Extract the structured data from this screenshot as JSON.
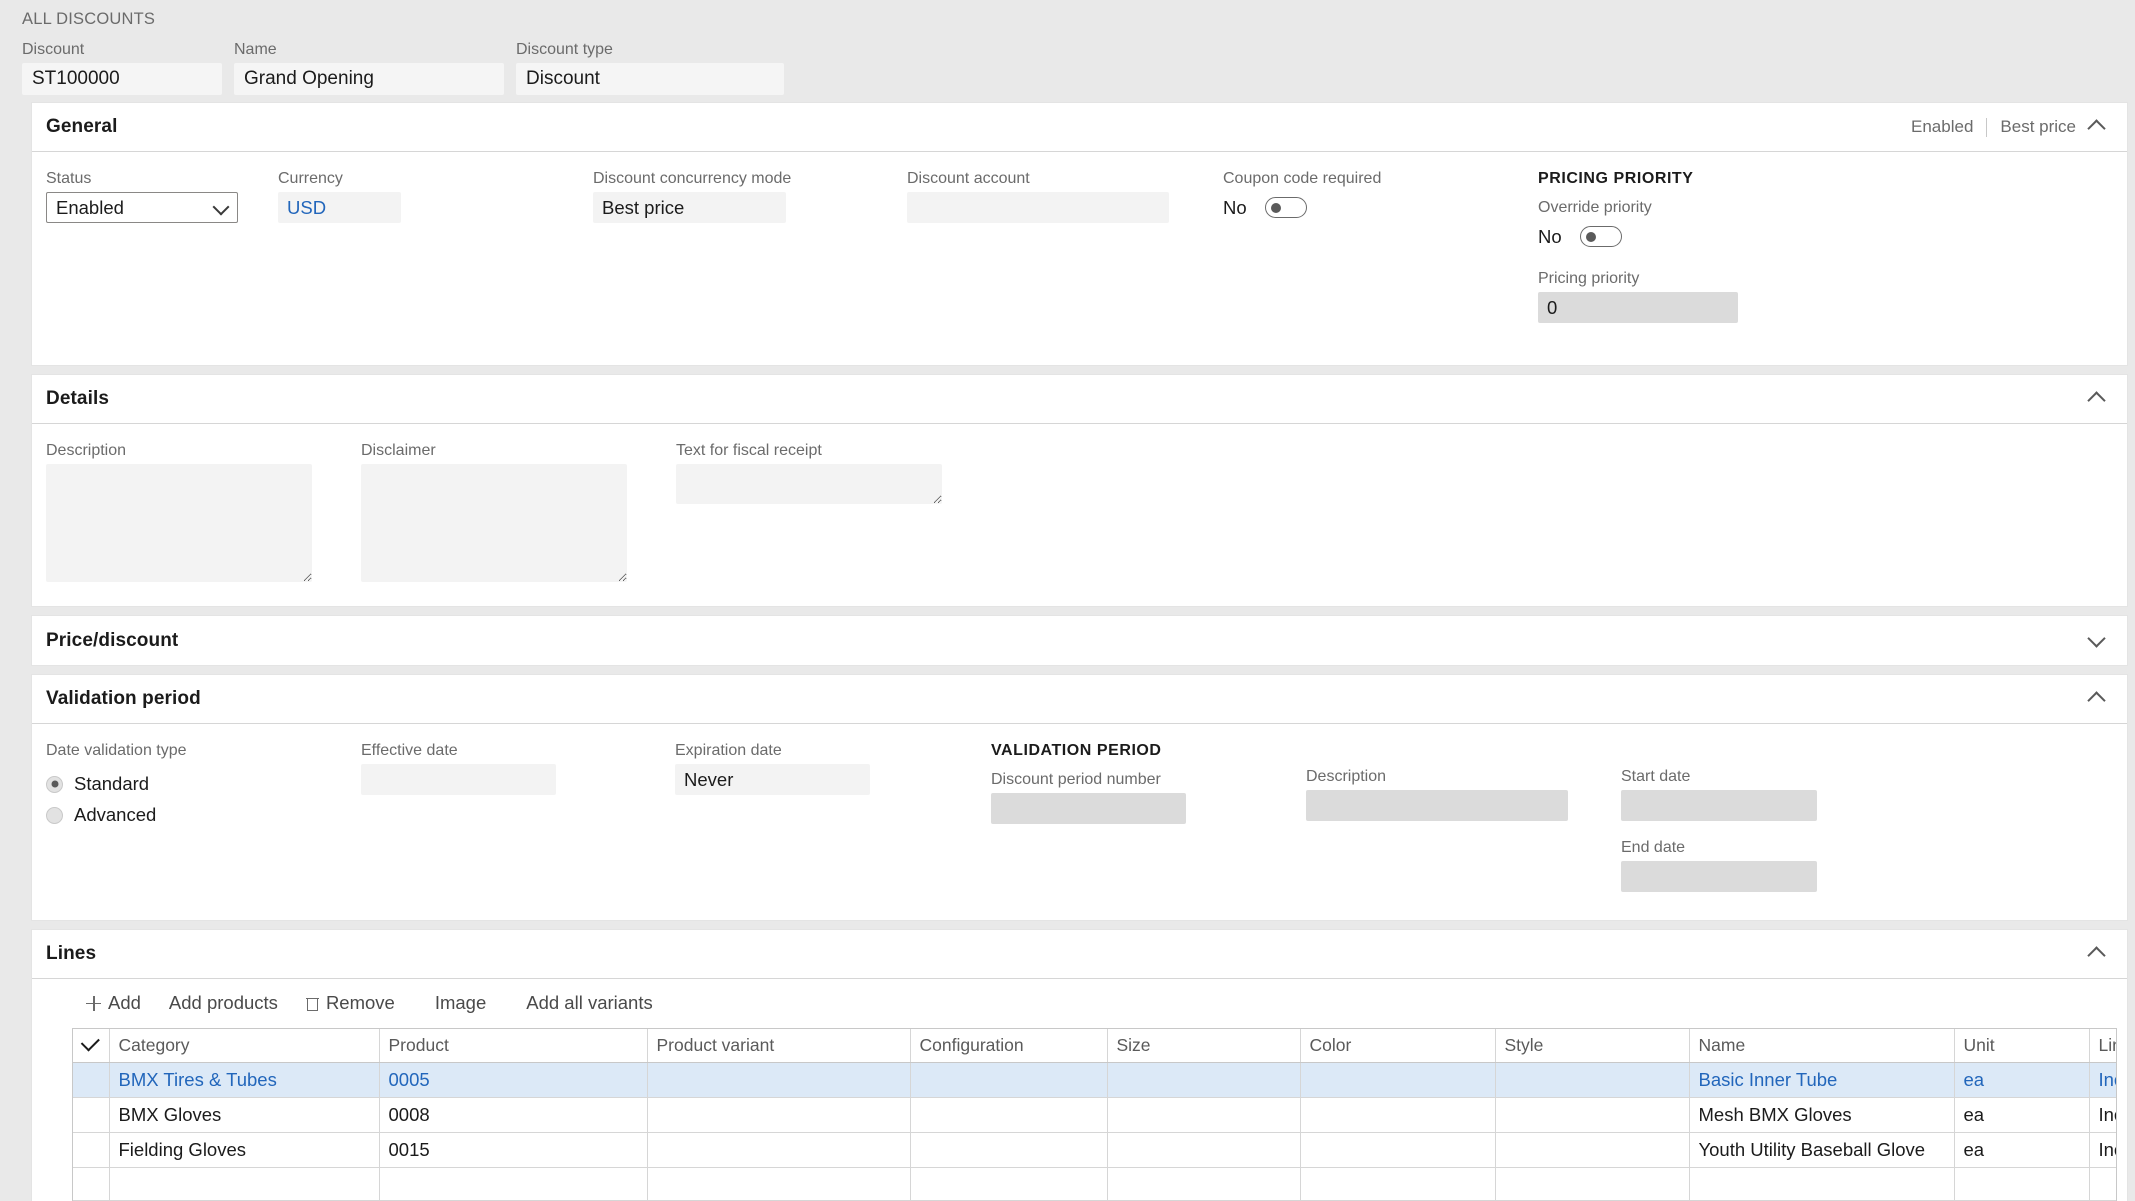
{
  "breadcrumb": "ALL DISCOUNTS",
  "header_fields": [
    {
      "label": "Discount",
      "value": "ST100000"
    },
    {
      "label": "Name",
      "value": "Grand Opening"
    },
    {
      "label": "Discount type",
      "value": "Discount"
    }
  ],
  "sections": {
    "general": {
      "title": "General",
      "status_summary": "Enabled",
      "mode_summary": "Best price",
      "status_label": "Status",
      "status_value": "Enabled",
      "currency_label": "Currency",
      "currency_value": "USD",
      "concurrency_label": "Discount concurrency mode",
      "concurrency_value": "Best price",
      "account_label": "Discount account",
      "account_value": "",
      "coupon_label": "Coupon code required",
      "coupon_value": "No",
      "pricing_priority_header": "PRICING PRIORITY",
      "override_label": "Override priority",
      "override_value": "No",
      "priority_label": "Pricing priority",
      "priority_value": "0"
    },
    "details": {
      "title": "Details",
      "description_label": "Description",
      "description_value": "",
      "disclaimer_label": "Disclaimer",
      "disclaimer_value": "",
      "fiscal_label": "Text for fiscal receipt",
      "fiscal_value": ""
    },
    "price_discount": {
      "title": "Price/discount"
    },
    "validation": {
      "title": "Validation period",
      "date_type_label": "Date validation type",
      "option_standard": "Standard",
      "option_advanced": "Advanced",
      "effective_label": "Effective date",
      "effective_value": "",
      "expiration_label": "Expiration date",
      "expiration_value": "Never",
      "sub_header": "VALIDATION PERIOD",
      "period_number_label": "Discount period number",
      "period_number_value": "",
      "description_label": "Description",
      "description_value": "",
      "start_label": "Start date",
      "start_value": "",
      "end_label": "End date",
      "end_value": ""
    },
    "lines": {
      "title": "Lines",
      "toolbar": [
        {
          "name": "add",
          "label": "Add",
          "icon": "plus-icon"
        },
        {
          "name": "add-products",
          "label": "Add products",
          "icon": ""
        },
        {
          "name": "remove",
          "label": "Remove",
          "icon": "trash-icon"
        },
        {
          "name": "image",
          "label": "Image",
          "icon": ""
        },
        {
          "name": "add-all-variants",
          "label": "Add all variants",
          "icon": ""
        }
      ],
      "columns": [
        "Category",
        "Product",
        "Product variant",
        "Configuration",
        "Size",
        "Color",
        "Style",
        "Name",
        "Unit",
        "Line"
      ],
      "rows": [
        {
          "selected": true,
          "Category": "BMX Tires & Tubes",
          "Product": "0005",
          "Product variant": "",
          "Configuration": "",
          "Size": "",
          "Color": "",
          "Style": "",
          "Name": "Basic Inner Tube",
          "Unit": "ea",
          "Line": "Incl"
        },
        {
          "selected": false,
          "Category": "BMX Gloves",
          "Product": "0008",
          "Product variant": "",
          "Configuration": "",
          "Size": "",
          "Color": "",
          "Style": "",
          "Name": "Mesh BMX Gloves",
          "Unit": "ea",
          "Line": "Incl"
        },
        {
          "selected": false,
          "Category": "Fielding Gloves",
          "Product": "0015",
          "Product variant": "",
          "Configuration": "",
          "Size": "",
          "Color": "",
          "Style": "",
          "Name": "Youth Utility Baseball Glove",
          "Unit": "ea",
          "Line": "Incl"
        },
        {
          "selected": false,
          "Category": "",
          "Product": "",
          "Product variant": "",
          "Configuration": "",
          "Size": "",
          "Color": "",
          "Style": "",
          "Name": "",
          "Unit": "",
          "Line": ""
        }
      ]
    }
  },
  "colors": {
    "accent_link": "#2266bb",
    "selected_row": "#dce9f7",
    "page_bg": "#e9e9e9",
    "card_bg": "#ffffff"
  }
}
